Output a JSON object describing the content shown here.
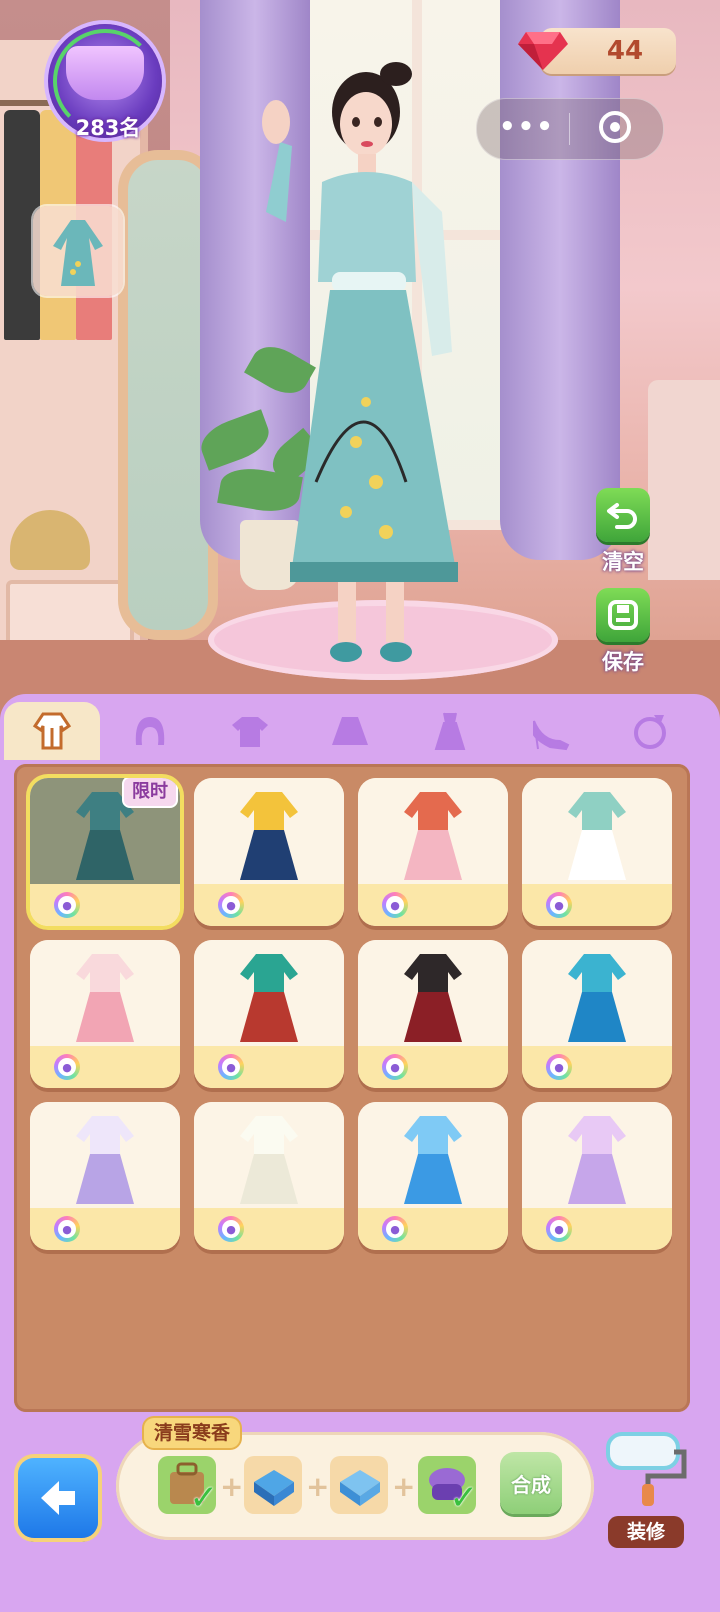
{
  "header": {
    "rank": "283名",
    "gems": "44"
  },
  "actions": {
    "clear_label": "清空",
    "save_label": "保存"
  },
  "tabs": [
    {
      "name": "outfit",
      "active": true
    },
    {
      "name": "hair"
    },
    {
      "name": "top"
    },
    {
      "name": "skirt"
    },
    {
      "name": "dress"
    },
    {
      "name": "shoes"
    },
    {
      "name": "accessory"
    }
  ],
  "items": [
    {
      "badge": "限时",
      "selected": true,
      "colors": [
        "#3e7f82",
        "#2f6467"
      ]
    },
    {
      "colors": [
        "#f3c33b",
        "#203f73"
      ]
    },
    {
      "colors": [
        "#e46a4e",
        "#f4b6c2"
      ]
    },
    {
      "colors": [
        "#8fd0c3",
        "#ffffff"
      ]
    },
    {
      "colors": [
        "#f9d9dc",
        "#f2a5b4"
      ]
    },
    {
      "colors": [
        "#2aa592",
        "#b8392f"
      ]
    },
    {
      "colors": [
        "#2e2829",
        "#8b1f26"
      ]
    },
    {
      "colors": [
        "#3bb3d0",
        "#1f86c6"
      ]
    },
    {
      "colors": [
        "#eee6fa",
        "#b8a4e6"
      ]
    },
    {
      "colors": [
        "#fbfbf1",
        "#ece9d8"
      ]
    },
    {
      "colors": [
        "#7fcaf5",
        "#3b9ae4"
      ]
    },
    {
      "colors": [
        "#e8c9f5",
        "#c6a6ea"
      ]
    }
  ],
  "craft": {
    "set_name": "清雪寒香",
    "craft_label": "合成",
    "pieces": [
      {
        "owned": true
      },
      {
        "owned": false
      },
      {
        "owned": false
      },
      {
        "owned": true
      }
    ]
  },
  "decor": {
    "label": "装修"
  }
}
